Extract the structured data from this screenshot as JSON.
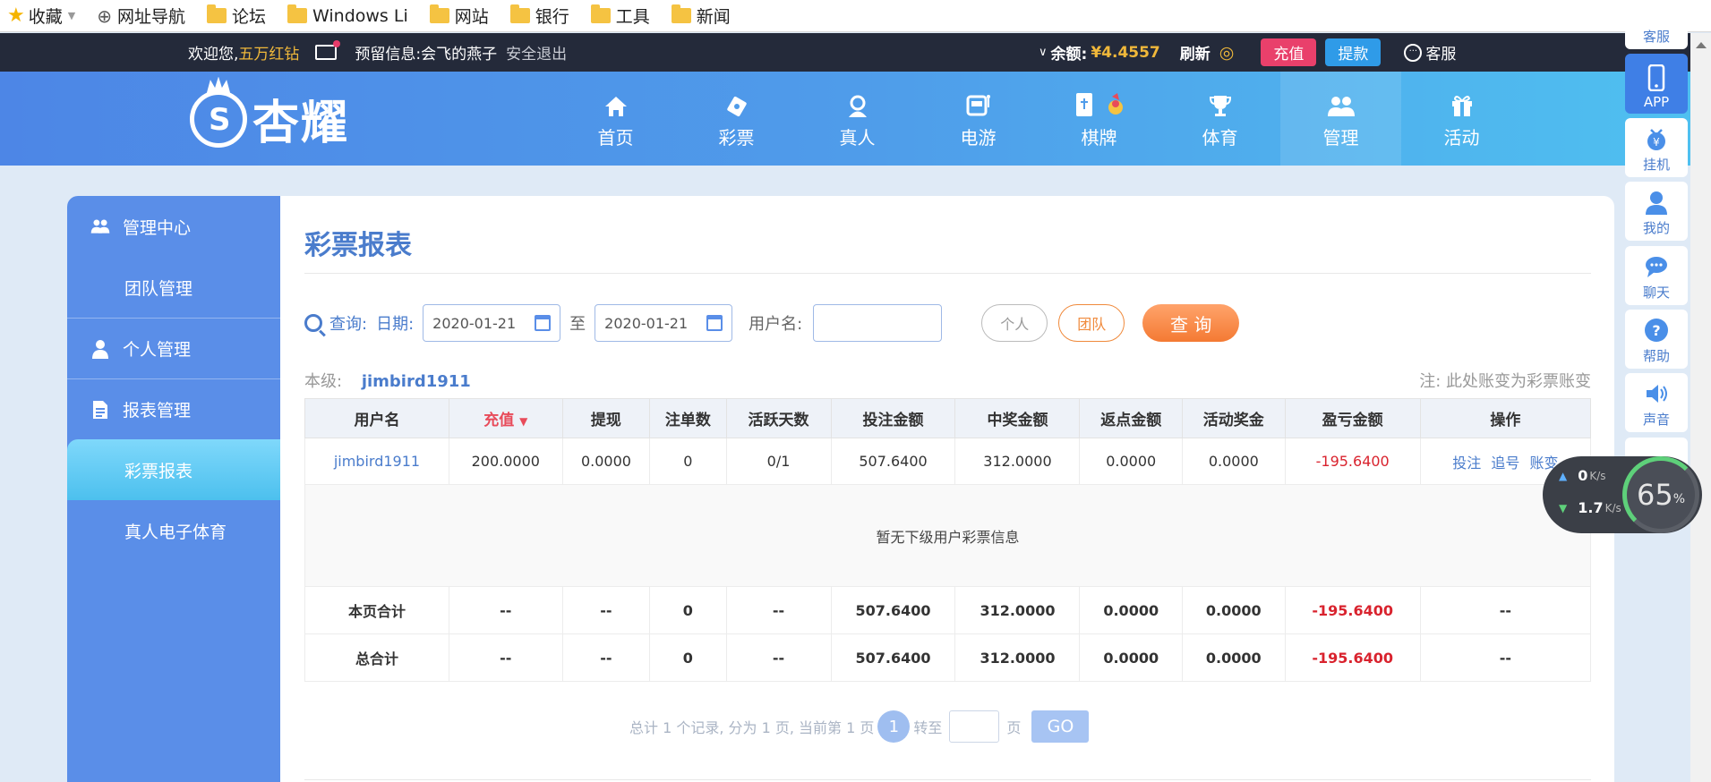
{
  "bookmarks": [
    {
      "label": "收藏",
      "icon": "star-icon"
    },
    {
      "label": "网址导航",
      "icon": "globe-icon"
    },
    {
      "label": "论坛",
      "icon": "folder-icon"
    },
    {
      "label": "Windows Li",
      "icon": "folder-icon"
    },
    {
      "label": "网站",
      "icon": "folder-icon"
    },
    {
      "label": "银行",
      "icon": "folder-icon"
    },
    {
      "label": "工具",
      "icon": "folder-icon"
    },
    {
      "label": "新闻",
      "icon": "folder-icon"
    }
  ],
  "topbar": {
    "welcome": "欢迎您,",
    "user_level": "五万红钻",
    "notice": "预留信息:会飞的燕子",
    "logout": "安全退出",
    "balance_label": "余额:",
    "balance_value": "¥4.4557",
    "refresh": "刷新",
    "charge": "充值",
    "withdraw": "提款",
    "service": "客服"
  },
  "logo": {
    "text": "杏耀"
  },
  "nav": [
    {
      "label": "首页",
      "icon": "home-icon"
    },
    {
      "label": "彩票",
      "icon": "lottery-ticket-icon"
    },
    {
      "label": "真人",
      "icon": "live-dealer-icon"
    },
    {
      "label": "电游",
      "icon": "slot-machine-icon"
    },
    {
      "label": "棋牌",
      "icon": "cards-icon"
    },
    {
      "label": "体育",
      "icon": "trophy-icon"
    },
    {
      "label": "管理",
      "icon": "users-icon"
    },
    {
      "label": "活动",
      "icon": "gift-icon"
    }
  ],
  "sidebar": {
    "sections": [
      {
        "label": "管理中心",
        "icon": "users-icon"
      },
      {
        "label": "团队管理"
      },
      {
        "label": "个人管理",
        "icon": "user-icon"
      },
      {
        "label": "报表管理",
        "icon": "report-icon"
      },
      {
        "label": "彩票报表"
      },
      {
        "label": "真人电子体育"
      }
    ]
  },
  "page": {
    "title": "彩票报表",
    "query_label": "查询:",
    "date_label": "日期:",
    "date_from": "2020-01-21",
    "to_label": "至",
    "date_to": "2020-01-21",
    "username_label": "用户名:",
    "username_value": "",
    "btn_personal": "个人",
    "btn_team": "团队",
    "btn_search": "查 询",
    "level_label": "本级:",
    "level_user": "jimbird1911",
    "note": "注: 此处账变为彩票账变"
  },
  "table": {
    "headers": [
      "用户名",
      "充值",
      "提现",
      "注单数",
      "活跃天数",
      "投注金额",
      "中奖金额",
      "返点金额",
      "活动奖金",
      "盈亏金额",
      "操作"
    ],
    "sorted_indicator": "▼",
    "row": [
      "jimbird1911",
      "200.0000",
      "0.0000",
      "0",
      "0/1",
      "507.6400",
      "312.0000",
      "0.0000",
      "0.0000",
      "-195.6400"
    ],
    "ops": [
      "投注",
      "追号",
      "账变"
    ],
    "empty_message": "暂无下级用户彩票信息",
    "page_total": [
      "本页合计",
      "--",
      "--",
      "0",
      "--",
      "507.6400",
      "312.0000",
      "0.0000",
      "0.0000",
      "-195.6400",
      "--"
    ],
    "grand_total": [
      "总合计",
      "--",
      "--",
      "0",
      "--",
      "507.6400",
      "312.0000",
      "0.0000",
      "0.0000",
      "-195.6400",
      "--"
    ]
  },
  "pager": {
    "summary": "总计 1 个记录, 分为 1 页, 当前第 1 页",
    "current": "1",
    "goto_label": "转至",
    "page_label": "页",
    "go": "GO"
  },
  "float_bar": [
    {
      "label": "客服"
    },
    {
      "label": "APP",
      "icon": "phone-icon"
    },
    {
      "label": "挂机",
      "icon": "robot-icon"
    },
    {
      "label": "我的",
      "icon": "user-icon"
    },
    {
      "label": "聊天",
      "icon": "chat-icon"
    },
    {
      "label": "帮助",
      "icon": "help-icon"
    },
    {
      "label": "声音",
      "icon": "speaker-icon"
    }
  ],
  "net": {
    "up": "0",
    "up_unit": "K/s",
    "down": "1.7",
    "down_unit": "K/s",
    "percent": "65",
    "percent_unit": "%"
  }
}
